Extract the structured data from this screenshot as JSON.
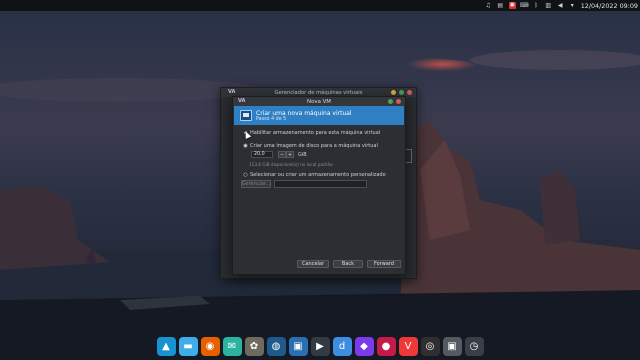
{
  "top_panel": {
    "clock": "12/04/2022 09:09",
    "tray_icons": [
      "notification-icon",
      "clipboard-icon",
      "vpn-icon",
      "keyboard-icon",
      "bluetooth-icon",
      "network-icon",
      "volume-icon",
      "chevron-down-icon"
    ]
  },
  "background_window": {
    "logo": "VA",
    "title": "Gerenciador de máquinas virtuais"
  },
  "dialog": {
    "logo": "VA",
    "title": "Nova VM",
    "banner": {
      "title": "Criar uma nova máquina virtual",
      "step": "Passo 4 de 5"
    },
    "enable_storage_label": "Habilitar armazenamento para esta máquina virtual",
    "create_disk_label": "Criar uma imagem de disco para a máquina virtual",
    "disk_size_value": "20,0",
    "spin_minus": "−",
    "spin_plus": "+",
    "disk_unit": "GiB",
    "available_hint": "113,6 GiB disponível(is) no local padrão",
    "custom_storage_label": "Selecionar ou criar um armazenamento personalizado",
    "manage_button": "Gerenciar...",
    "path_placeholder": "",
    "buttons": {
      "cancel": "Cancelar",
      "back": "Back",
      "forward": "Forward"
    }
  },
  "colors": {
    "banner_blue": "#2f7fc4",
    "dialog_bg": "#2b2e32",
    "panel_bg": "#101216"
  },
  "dock": {
    "apps": [
      {
        "name": "arch-launcher-icon",
        "glyph": "▲",
        "color": "#1793d1"
      },
      {
        "name": "files-icon",
        "glyph": "▬",
        "color": "#3daee9"
      },
      {
        "name": "firefox-icon",
        "glyph": "◉",
        "color": "#e66000"
      },
      {
        "name": "mail-icon",
        "glyph": "✉",
        "color": "#2bb3a0"
      },
      {
        "name": "gimp-icon",
        "glyph": "✿",
        "color": "#6e6a5e"
      },
      {
        "name": "audio-icon",
        "glyph": "◍",
        "color": "#1e5a8c"
      },
      {
        "name": "monitor-icon",
        "glyph": "▣",
        "color": "#2a6fb0"
      },
      {
        "name": "video-player-icon",
        "glyph": "▶",
        "color": "#333a44"
      },
      {
        "name": "d-app-icon",
        "glyph": "d",
        "color": "#3d8ee0"
      },
      {
        "name": "obsidian-icon",
        "glyph": "◆",
        "color": "#7c3aed"
      },
      {
        "name": "raspberry-icon",
        "glyph": "●",
        "color": "#c51a4a"
      },
      {
        "name": "vivaldi-icon",
        "glyph": "V",
        "color": "#ef3939"
      },
      {
        "name": "obs-icon",
        "glyph": "◎",
        "color": "#302e31"
      },
      {
        "name": "virtual-machine-manager-icon",
        "glyph": "▣",
        "color": "#555a61"
      },
      {
        "name": "clock-app-icon",
        "glyph": "◷",
        "color": "#3a3f47"
      }
    ]
  }
}
